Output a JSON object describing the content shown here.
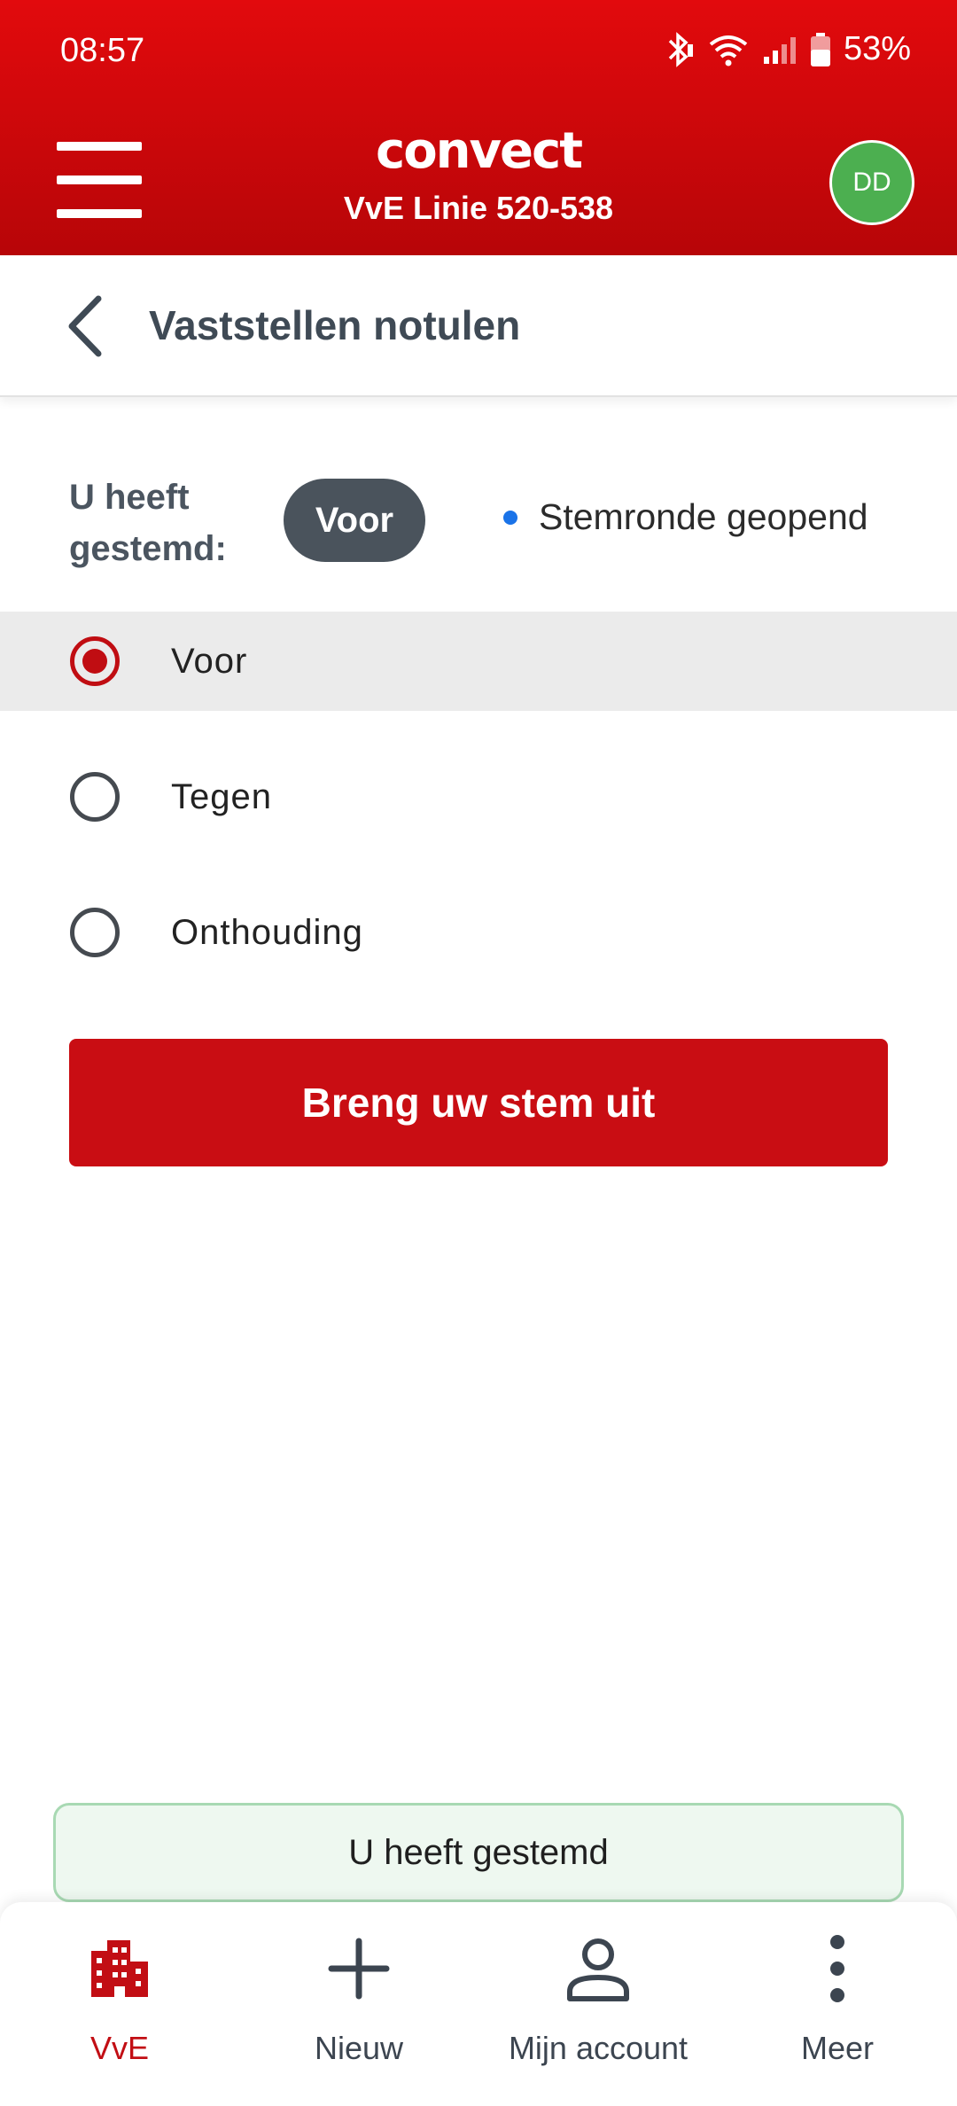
{
  "status_bar": {
    "time": "08:57",
    "battery": "53%"
  },
  "header": {
    "logo": "convect",
    "subtitle": "VvE Linie 520-538",
    "avatar_initials": "DD",
    "avatar_color": "#4caf50"
  },
  "page": {
    "title": "Vaststellen notulen"
  },
  "vote": {
    "voted_label": "U heeft gestemd:",
    "chip": "Voor",
    "round_status": "Stemronde geopend",
    "options": [
      {
        "label": "Voor",
        "selected": true
      },
      {
        "label": "Tegen",
        "selected": false
      },
      {
        "label": "Onthouding",
        "selected": false
      }
    ],
    "submit_label": "Breng uw stem uit"
  },
  "toast": {
    "message": "U heeft gestemd"
  },
  "bottom_nav": [
    {
      "label": "VvE",
      "icon": "building-icon",
      "active": true
    },
    {
      "label": "Nieuw",
      "icon": "plus-icon",
      "active": false
    },
    {
      "label": "Mijn account",
      "icon": "person-icon",
      "active": false
    },
    {
      "label": "Meer",
      "icon": "more-vert-icon",
      "active": false
    }
  ],
  "colors": {
    "brand_red": "#c90d13",
    "accent_blue": "#1a73e8",
    "chip_dark": "#4a535c"
  }
}
